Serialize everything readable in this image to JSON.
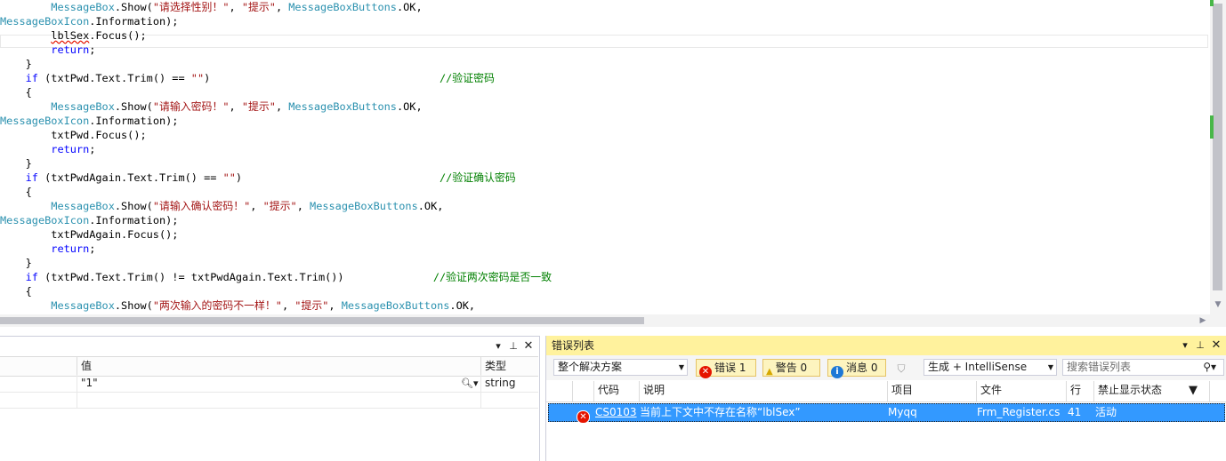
{
  "editor": {
    "lines": [
      [
        {
          "t": "        "
        },
        {
          "c": "t",
          "t": "MessageBox"
        },
        {
          "t": ".Show("
        },
        {
          "c": "s",
          "t": "\"请选择性别！\""
        },
        {
          "t": ", "
        },
        {
          "c": "s",
          "t": "\"提示\""
        },
        {
          "t": ", "
        },
        {
          "c": "t",
          "t": "MessageBoxButtons"
        },
        {
          "t": ".OK,"
        }
      ],
      [
        {
          "c": "t",
          "t": "MessageBoxIcon"
        },
        {
          "t": ".Information);"
        }
      ],
      [
        {
          "t": "        "
        },
        {
          "c": "err",
          "t": "lblSex"
        },
        {
          "t": ".Focus();"
        }
      ],
      [
        {
          "t": "        "
        },
        {
          "c": "k",
          "t": "return"
        },
        {
          "t": ";"
        }
      ],
      [
        {
          "t": "    }"
        }
      ],
      [
        {
          "t": "    "
        },
        {
          "c": "k",
          "t": "if"
        },
        {
          "t": " (txtPwd.Text.Trim() == "
        },
        {
          "c": "s",
          "t": "\"\""
        },
        {
          "t": ")                                    "
        },
        {
          "c": "c",
          "t": "//验证密码"
        }
      ],
      [
        {
          "t": "    {"
        }
      ],
      [
        {
          "t": "        "
        },
        {
          "c": "t",
          "t": "MessageBox"
        },
        {
          "t": ".Show("
        },
        {
          "c": "s",
          "t": "\"请输入密码！\""
        },
        {
          "t": ", "
        },
        {
          "c": "s",
          "t": "\"提示\""
        },
        {
          "t": ", "
        },
        {
          "c": "t",
          "t": "MessageBoxButtons"
        },
        {
          "t": ".OK,"
        }
      ],
      [
        {
          "c": "t",
          "t": "MessageBoxIcon"
        },
        {
          "t": ".Information);"
        }
      ],
      [
        {
          "t": "        txtPwd.Focus();"
        }
      ],
      [
        {
          "t": "        "
        },
        {
          "c": "k",
          "t": "return"
        },
        {
          "t": ";"
        }
      ],
      [
        {
          "t": "    }"
        }
      ],
      [
        {
          "t": "    "
        },
        {
          "c": "k",
          "t": "if"
        },
        {
          "t": " (txtPwdAgain.Text.Trim() == "
        },
        {
          "c": "s",
          "t": "\"\""
        },
        {
          "t": ")                               "
        },
        {
          "c": "c",
          "t": "//验证确认密码"
        }
      ],
      [
        {
          "t": "    {"
        }
      ],
      [
        {
          "t": "        "
        },
        {
          "c": "t",
          "t": "MessageBox"
        },
        {
          "t": ".Show("
        },
        {
          "c": "s",
          "t": "\"请输入确认密码！\""
        },
        {
          "t": ", "
        },
        {
          "c": "s",
          "t": "\"提示\""
        },
        {
          "t": ", "
        },
        {
          "c": "t",
          "t": "MessageBoxButtons"
        },
        {
          "t": ".OK,"
        }
      ],
      [
        {
          "c": "t",
          "t": "MessageBoxIcon"
        },
        {
          "t": ".Information);"
        }
      ],
      [
        {
          "t": "        txtPwdAgain.Focus();"
        }
      ],
      [
        {
          "t": "        "
        },
        {
          "c": "k",
          "t": "return"
        },
        {
          "t": ";"
        }
      ],
      [
        {
          "t": "    }"
        }
      ],
      [
        {
          "t": "    "
        },
        {
          "c": "k",
          "t": "if"
        },
        {
          "t": " (txtPwd.Text.Trim() != txtPwdAgain.Text.Trim())              "
        },
        {
          "c": "c",
          "t": "//验证两次密码是否一致"
        }
      ],
      [
        {
          "t": "    {"
        }
      ],
      [
        {
          "t": "        "
        },
        {
          "c": "t",
          "t": "MessageBox"
        },
        {
          "t": ".Show("
        },
        {
          "c": "s",
          "t": "\"两次输入的密码不一样！\""
        },
        {
          "t": ", "
        },
        {
          "c": "s",
          "t": "\"提示\""
        },
        {
          "t": ", "
        },
        {
          "c": "t",
          "t": "MessageBoxButtons"
        },
        {
          "t": ".OK,"
        }
      ]
    ]
  },
  "left_panel": {
    "pin_icon": "pin-icon",
    "close_icon": "close-icon",
    "columns": {
      "value": "值",
      "type": "类型"
    },
    "row": {
      "value": "\"1\"",
      "type": "string"
    }
  },
  "error_list": {
    "title": "错误列表",
    "scope": "整个解决方案",
    "errors_label": "错误 1",
    "warnings_label": "警告 0",
    "messages_label": "消息 0",
    "build_filter": "生成 + IntelliSense",
    "search_placeholder": "搜索错误列表",
    "columns": {
      "code": "代码",
      "description": "说明",
      "project": "项目",
      "file": "文件",
      "line": "行",
      "suppression": "禁止显示状态"
    },
    "rows": [
      {
        "code": "CS0103",
        "description": "当前上下文中不存在名称“lblSex”",
        "project": "Myqq",
        "file": "Frm_Register.cs",
        "line": "41",
        "suppression": "活动"
      }
    ],
    "colors": {
      "selected": "#3399ff",
      "title_bg": "#fff29d",
      "error_red": "#e51400"
    }
  }
}
